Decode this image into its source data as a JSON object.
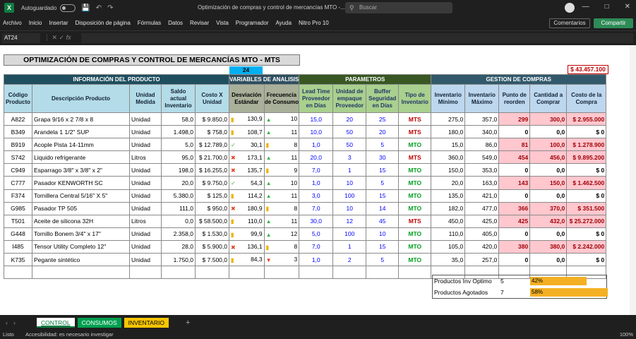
{
  "app": {
    "autosave": "Autoguardado",
    "window_title": "Optimización de compras y control de mercancías MTO -...",
    "search_placeholder": "Buscar"
  },
  "menu": [
    "Archivo",
    "Inicio",
    "Insertar",
    "Disposición de página",
    "Fórmulas",
    "Datos",
    "Revisar",
    "Vista",
    "Programador",
    "Ayuda",
    "Nitro Pro 10"
  ],
  "buttons": {
    "comments": "Comentarios",
    "share": "Compartir"
  },
  "formula": {
    "cell": "AT24",
    "fx": "fx"
  },
  "sheet": {
    "title": "OPTIMIZACIÓN DE COMPRAS Y CONTROL DE MERCANCÍAS MTO - MTS",
    "day_value": "24",
    "grand_total": "$ 43.457.100",
    "groups": {
      "info": "INFORMACIÓN DEL PRODUCTO",
      "vars": "VARIABLES DE ANALISIS",
      "params": "PARAMETROS",
      "gestion": "GESTION DE COMPRAS"
    },
    "headers": [
      "Código Producto",
      "Descripción Producto",
      "Unidad Medida",
      "Saldo actual Inventario",
      "Costo X Unidad",
      "Desviación Estándar",
      "Frecuencia de Consumo",
      "Lead Time Proveedor en Días",
      "Unidad de empaque Proveedor",
      "Buffer Seguridad en Días",
      "Tipo de Inventario",
      "Inventario Mínimo",
      "Inventario Máximo",
      "Punto de reorden",
      "Cantidad a Comprar",
      "Costo de la Compra"
    ],
    "rows": [
      [
        "A822",
        "Grapa 9/16 x 2 7/8 x 8",
        "Unidad",
        "58,0",
        "$ 9.850,0",
        "side",
        "130,9",
        "up",
        "10",
        "15,0",
        "20",
        "25",
        "MTS",
        "275,0",
        "357,0",
        "299",
        "300,0",
        "$ 2.955.000"
      ],
      [
        "B349",
        "Arandela 1 1/2\" SUP",
        "Unidad",
        "1.498,0",
        "$ 758,0",
        "side",
        "108,7",
        "up",
        "11",
        "10,0",
        "50",
        "20",
        "MTS",
        "180,0",
        "340,0",
        "0",
        "0,0",
        "$ 0"
      ],
      [
        "B919",
        "Acople Pista 14-11mm",
        "Unidad",
        "5,0",
        "$ 12.789,0",
        "ok",
        "30,1",
        "side",
        "8",
        "1,0",
        "50",
        "5",
        "MTO",
        "15,0",
        "86,0",
        "81",
        "100,0",
        "$ 1.278.900"
      ],
      [
        "S742",
        "Liquido refrigerante",
        "Litros",
        "95,0",
        "$ 21.700,0",
        "x",
        "173,1",
        "up",
        "11",
        "20,0",
        "3",
        "30",
        "MTS",
        "360,0",
        "549,0",
        "454",
        "456,0",
        "$ 9.895.200"
      ],
      [
        "C949",
        "Esparrago 3/8\" x 3/8\" x 2\"",
        "Unidad",
        "198,0",
        "$ 16.255,0",
        "x",
        "135,7",
        "side",
        "9",
        "7,0",
        "1",
        "15",
        "MTO",
        "150,0",
        "353,0",
        "0",
        "0,0",
        "$ 0"
      ],
      [
        "C777",
        "Pasador KENWORTH SC",
        "Unidad",
        "20,0",
        "$ 9.750,0",
        "ok",
        "54,3",
        "up",
        "10",
        "1,0",
        "10",
        "5",
        "MTO",
        "20,0",
        "163,0",
        "143",
        "150,0",
        "$ 1.462.500"
      ],
      [
        "F374",
        "Tornillera Central 5/16\" X 5\"",
        "Unidad",
        "5.380,0",
        "$ 125,0",
        "side",
        "114,2",
        "up",
        "11",
        "3,0",
        "100",
        "15",
        "MTO",
        "135,0",
        "421,0",
        "0",
        "0,0",
        "$ 0"
      ],
      [
        "G985",
        "Pasador TP 505",
        "Unidad",
        "111,0",
        "$ 950,0",
        "x",
        "180,9",
        "side",
        "8",
        "7,0",
        "10",
        "14",
        "MTO",
        "182,0",
        "477,0",
        "366",
        "370,0",
        "$ 351.500"
      ],
      [
        "T501",
        "Aceite de silicona 32H",
        "Litros",
        "0,0",
        "$ 58.500,0",
        "side",
        "110,0",
        "up",
        "11",
        "30,0",
        "12",
        "45",
        "MTS",
        "450,0",
        "425,0",
        "425",
        "432,0",
        "$ 25.272.000"
      ],
      [
        "G448",
        "Tornillo Bonem 3/4\" x 17\"",
        "Unidad",
        "2.358,0",
        "$ 1.530,0",
        "side",
        "99,9",
        "up",
        "12",
        "5,0",
        "100",
        "10",
        "MTO",
        "110,0",
        "405,0",
        "0",
        "0,0",
        "$ 0"
      ],
      [
        "I485",
        "Tensor Utility Completo 12\"",
        "Unidad",
        "28,0",
        "$ 5.900,0",
        "x",
        "136,1",
        "side",
        "8",
        "7,0",
        "1",
        "15",
        "MTO",
        "105,0",
        "420,0",
        "380",
        "380,0",
        "$ 2.242.000"
      ],
      [
        "K735",
        "Pegante sintético",
        "Unidad",
        "1.750,0",
        "$ 7.500,0",
        "side",
        "84,3",
        "down",
        "3",
        "1,0",
        "2",
        "5",
        "MTO",
        "35,0",
        "257,0",
        "0",
        "0,0",
        "$ 0"
      ]
    ],
    "summary": {
      "opt_label": "Productos Inv Optimo",
      "opt_count": "5",
      "opt_pct": "42%",
      "opt_fraction": 0.42,
      "out_label": "Productos Agotados",
      "out_count": "7",
      "out_pct": "58%",
      "out_fraction": 0.58
    }
  },
  "tabs": {
    "control": "CONTROL",
    "consumos": "CONSUMOS",
    "inventario": "INVENTARIO"
  },
  "status": {
    "ready": "Listo",
    "accessibility": "Accesibilidad: es necesario investigar",
    "zoom": "100%"
  },
  "colors": {
    "excel_green": "#107c41",
    "reorder_fill": "#ffc7ce",
    "bar": "#f4b024"
  }
}
